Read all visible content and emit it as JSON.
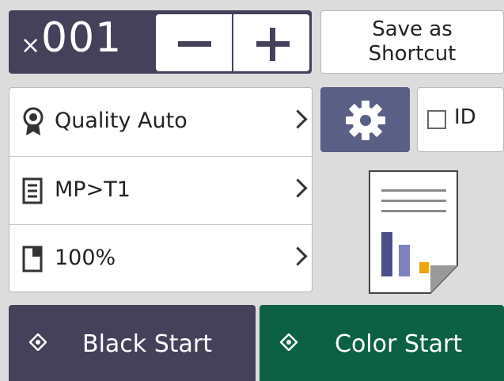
{
  "copies": {
    "prefix": "×",
    "count": "001"
  },
  "stepper": {
    "decrease_icon": "minus-icon",
    "increase_icon": "plus-icon"
  },
  "save_shortcut": {
    "label": "Save as\nShortcut"
  },
  "settings_list": [
    {
      "label": "Quality Auto",
      "icon": "quality-ribbon-icon"
    },
    {
      "label": "MP>T1",
      "icon": "paper-tray-icon"
    },
    {
      "label": "100%",
      "icon": "enlarge-reduce-icon"
    }
  ],
  "settings_button": {
    "icon": "gear-icon"
  },
  "id_copy": {
    "label": "ID",
    "checked": false
  },
  "preview": {
    "icon": "document-preview-icon"
  },
  "black_start": {
    "label": "Black Start",
    "icon": "start-diamond-icon"
  },
  "color_start": {
    "label": "Color Start",
    "icon": "start-diamond-icon"
  },
  "colors": {
    "dark_panel": "#45415a",
    "gear_button": "#5a5f86",
    "color_start": "#0c6145",
    "background": "#dcdcdc"
  }
}
